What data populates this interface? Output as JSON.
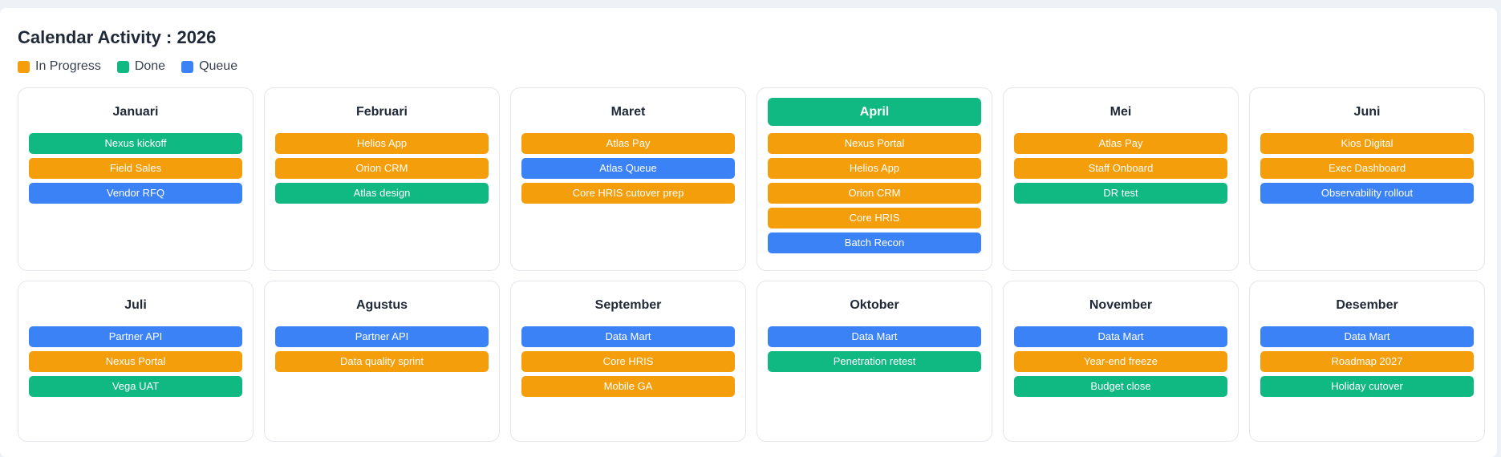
{
  "title": "Calendar Activity : 2026",
  "colors": {
    "in_progress": "#f59e0b",
    "done": "#10b981",
    "queue": "#3b82f6"
  },
  "legend": [
    {
      "label": "In Progress",
      "status": "in-progress"
    },
    {
      "label": "Done",
      "status": "done"
    },
    {
      "label": "Queue",
      "status": "queue"
    }
  ],
  "months": [
    {
      "name": "Januari",
      "active": false,
      "tasks": [
        {
          "label": "Nexus kickoff",
          "status": "done"
        },
        {
          "label": "Field Sales",
          "status": "in-progress"
        },
        {
          "label": "Vendor RFQ",
          "status": "queue"
        }
      ]
    },
    {
      "name": "Februari",
      "active": false,
      "tasks": [
        {
          "label": "Helios App",
          "status": "in-progress"
        },
        {
          "label": "Orion CRM",
          "status": "in-progress"
        },
        {
          "label": "Atlas design",
          "status": "done"
        }
      ]
    },
    {
      "name": "Maret",
      "active": false,
      "tasks": [
        {
          "label": "Atlas Pay",
          "status": "in-progress"
        },
        {
          "label": "Atlas Queue",
          "status": "queue"
        },
        {
          "label": "Core HRIS cutover prep",
          "status": "in-progress"
        }
      ]
    },
    {
      "name": "April",
      "active": true,
      "tasks": [
        {
          "label": "Nexus Portal",
          "status": "in-progress"
        },
        {
          "label": "Helios App",
          "status": "in-progress"
        },
        {
          "label": "Orion CRM",
          "status": "in-progress"
        },
        {
          "label": "Core HRIS",
          "status": "in-progress"
        },
        {
          "label": "Batch Recon",
          "status": "queue"
        }
      ]
    },
    {
      "name": "Mei",
      "active": false,
      "tasks": [
        {
          "label": "Atlas Pay",
          "status": "in-progress"
        },
        {
          "label": "Staff Onboard",
          "status": "in-progress"
        },
        {
          "label": "DR test",
          "status": "done"
        }
      ]
    },
    {
      "name": "Juni",
      "active": false,
      "tasks": [
        {
          "label": "Kios Digital",
          "status": "in-progress"
        },
        {
          "label": "Exec Dashboard",
          "status": "in-progress"
        },
        {
          "label": "Observability rollout",
          "status": "queue"
        }
      ]
    },
    {
      "name": "Juli",
      "active": false,
      "tasks": [
        {
          "label": "Partner API",
          "status": "queue"
        },
        {
          "label": "Nexus Portal",
          "status": "in-progress"
        },
        {
          "label": "Vega UAT",
          "status": "done"
        }
      ]
    },
    {
      "name": "Agustus",
      "active": false,
      "tasks": [
        {
          "label": "Partner API",
          "status": "queue"
        },
        {
          "label": "Data quality sprint",
          "status": "in-progress"
        }
      ]
    },
    {
      "name": "September",
      "active": false,
      "tasks": [
        {
          "label": "Data Mart",
          "status": "queue"
        },
        {
          "label": "Core HRIS",
          "status": "in-progress"
        },
        {
          "label": "Mobile GA",
          "status": "in-progress"
        }
      ]
    },
    {
      "name": "Oktober",
      "active": false,
      "tasks": [
        {
          "label": "Data Mart",
          "status": "queue"
        },
        {
          "label": "Penetration retest",
          "status": "done"
        }
      ]
    },
    {
      "name": "November",
      "active": false,
      "tasks": [
        {
          "label": "Data Mart",
          "status": "queue"
        },
        {
          "label": "Year-end freeze",
          "status": "in-progress"
        },
        {
          "label": "Budget close",
          "status": "done"
        }
      ]
    },
    {
      "name": "Desember",
      "active": false,
      "tasks": [
        {
          "label": "Data Mart",
          "status": "queue"
        },
        {
          "label": "Roadmap 2027",
          "status": "in-progress"
        },
        {
          "label": "Holiday cutover",
          "status": "done"
        }
      ]
    }
  ]
}
